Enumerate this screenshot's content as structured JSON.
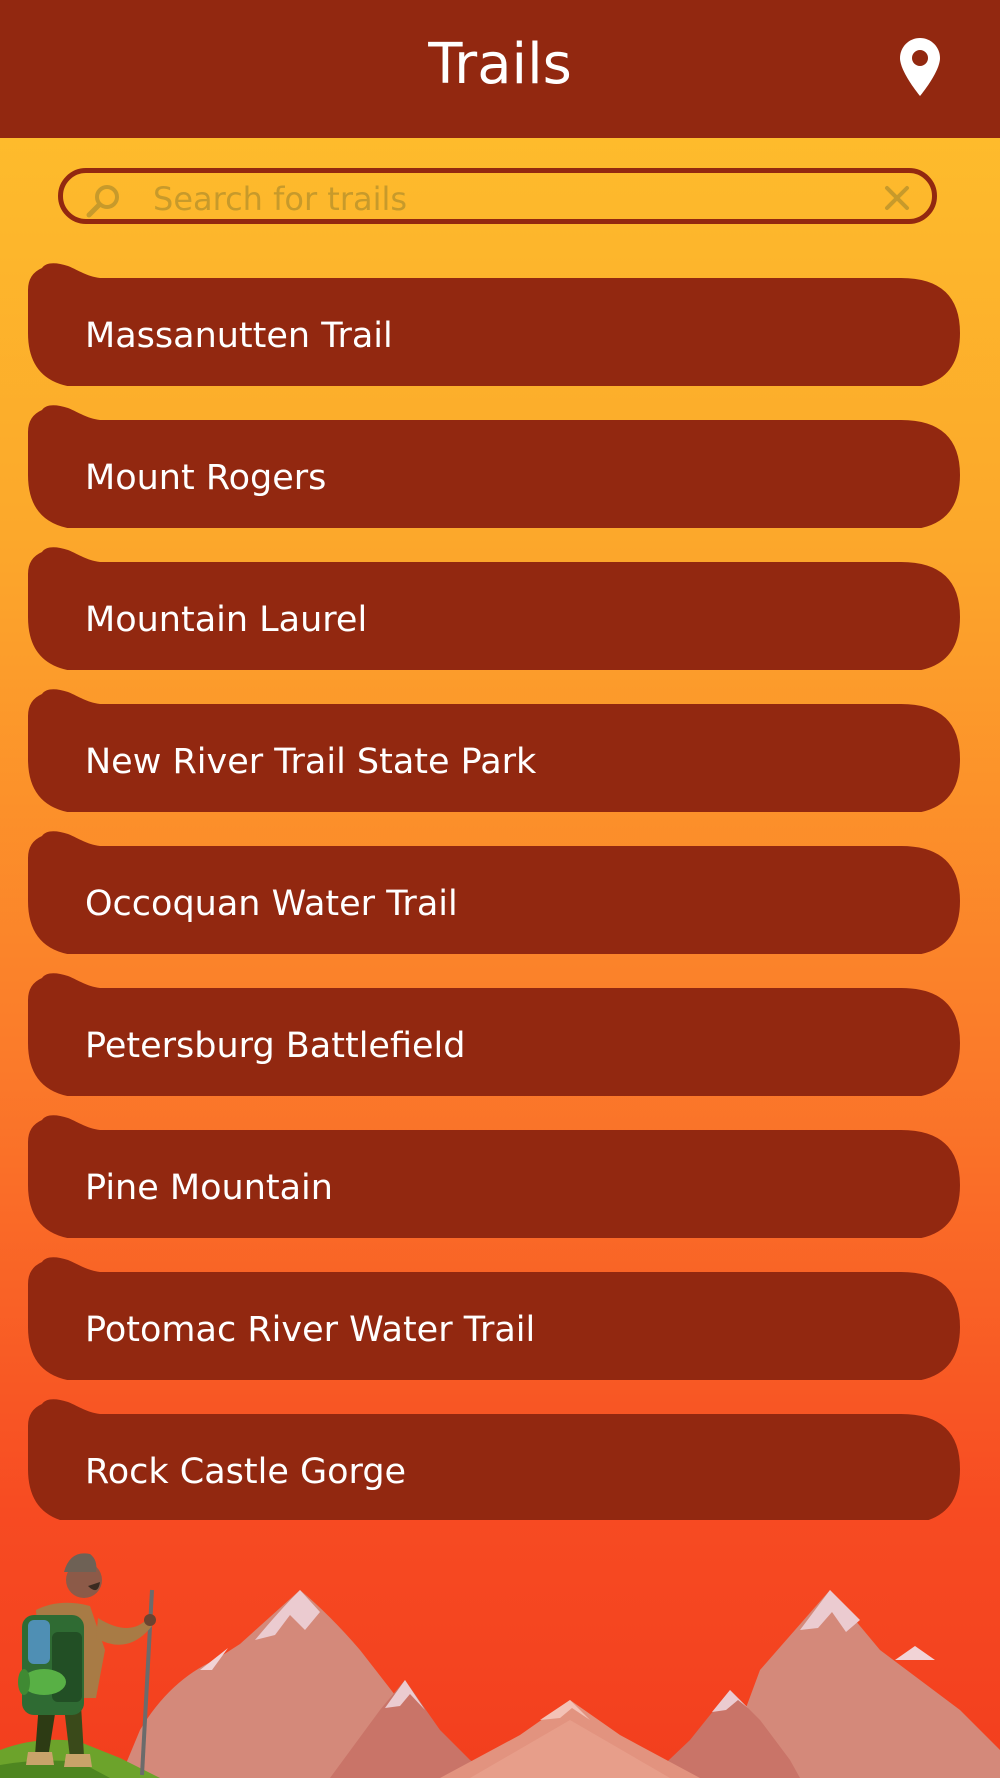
{
  "header": {
    "title": "Trails",
    "location_icon": "map-pin-icon"
  },
  "search": {
    "placeholder": "Search for trails",
    "value": "",
    "search_icon": "search-icon",
    "clear_icon": "close-icon"
  },
  "trails": [
    {
      "label": "Massanutten Trail"
    },
    {
      "label": "Mount Rogers"
    },
    {
      "label": "Mountain Laurel"
    },
    {
      "label": "New River Trail State Park"
    },
    {
      "label": "Occoquan Water Trail"
    },
    {
      "label": "Petersburg Battlefield"
    },
    {
      "label": "Pine Mountain"
    },
    {
      "label": "Potomac River Water Trail"
    },
    {
      "label": "Rock Castle Gorge"
    }
  ],
  "colors": {
    "brand_dark": "#922810",
    "gradient_top": "#FEC22C",
    "gradient_bottom": "#F23E1E",
    "text_on_dark": "#FFFFFF"
  },
  "illustration": {
    "figure": "hiker-illustration",
    "background": "mountains-illustration"
  }
}
